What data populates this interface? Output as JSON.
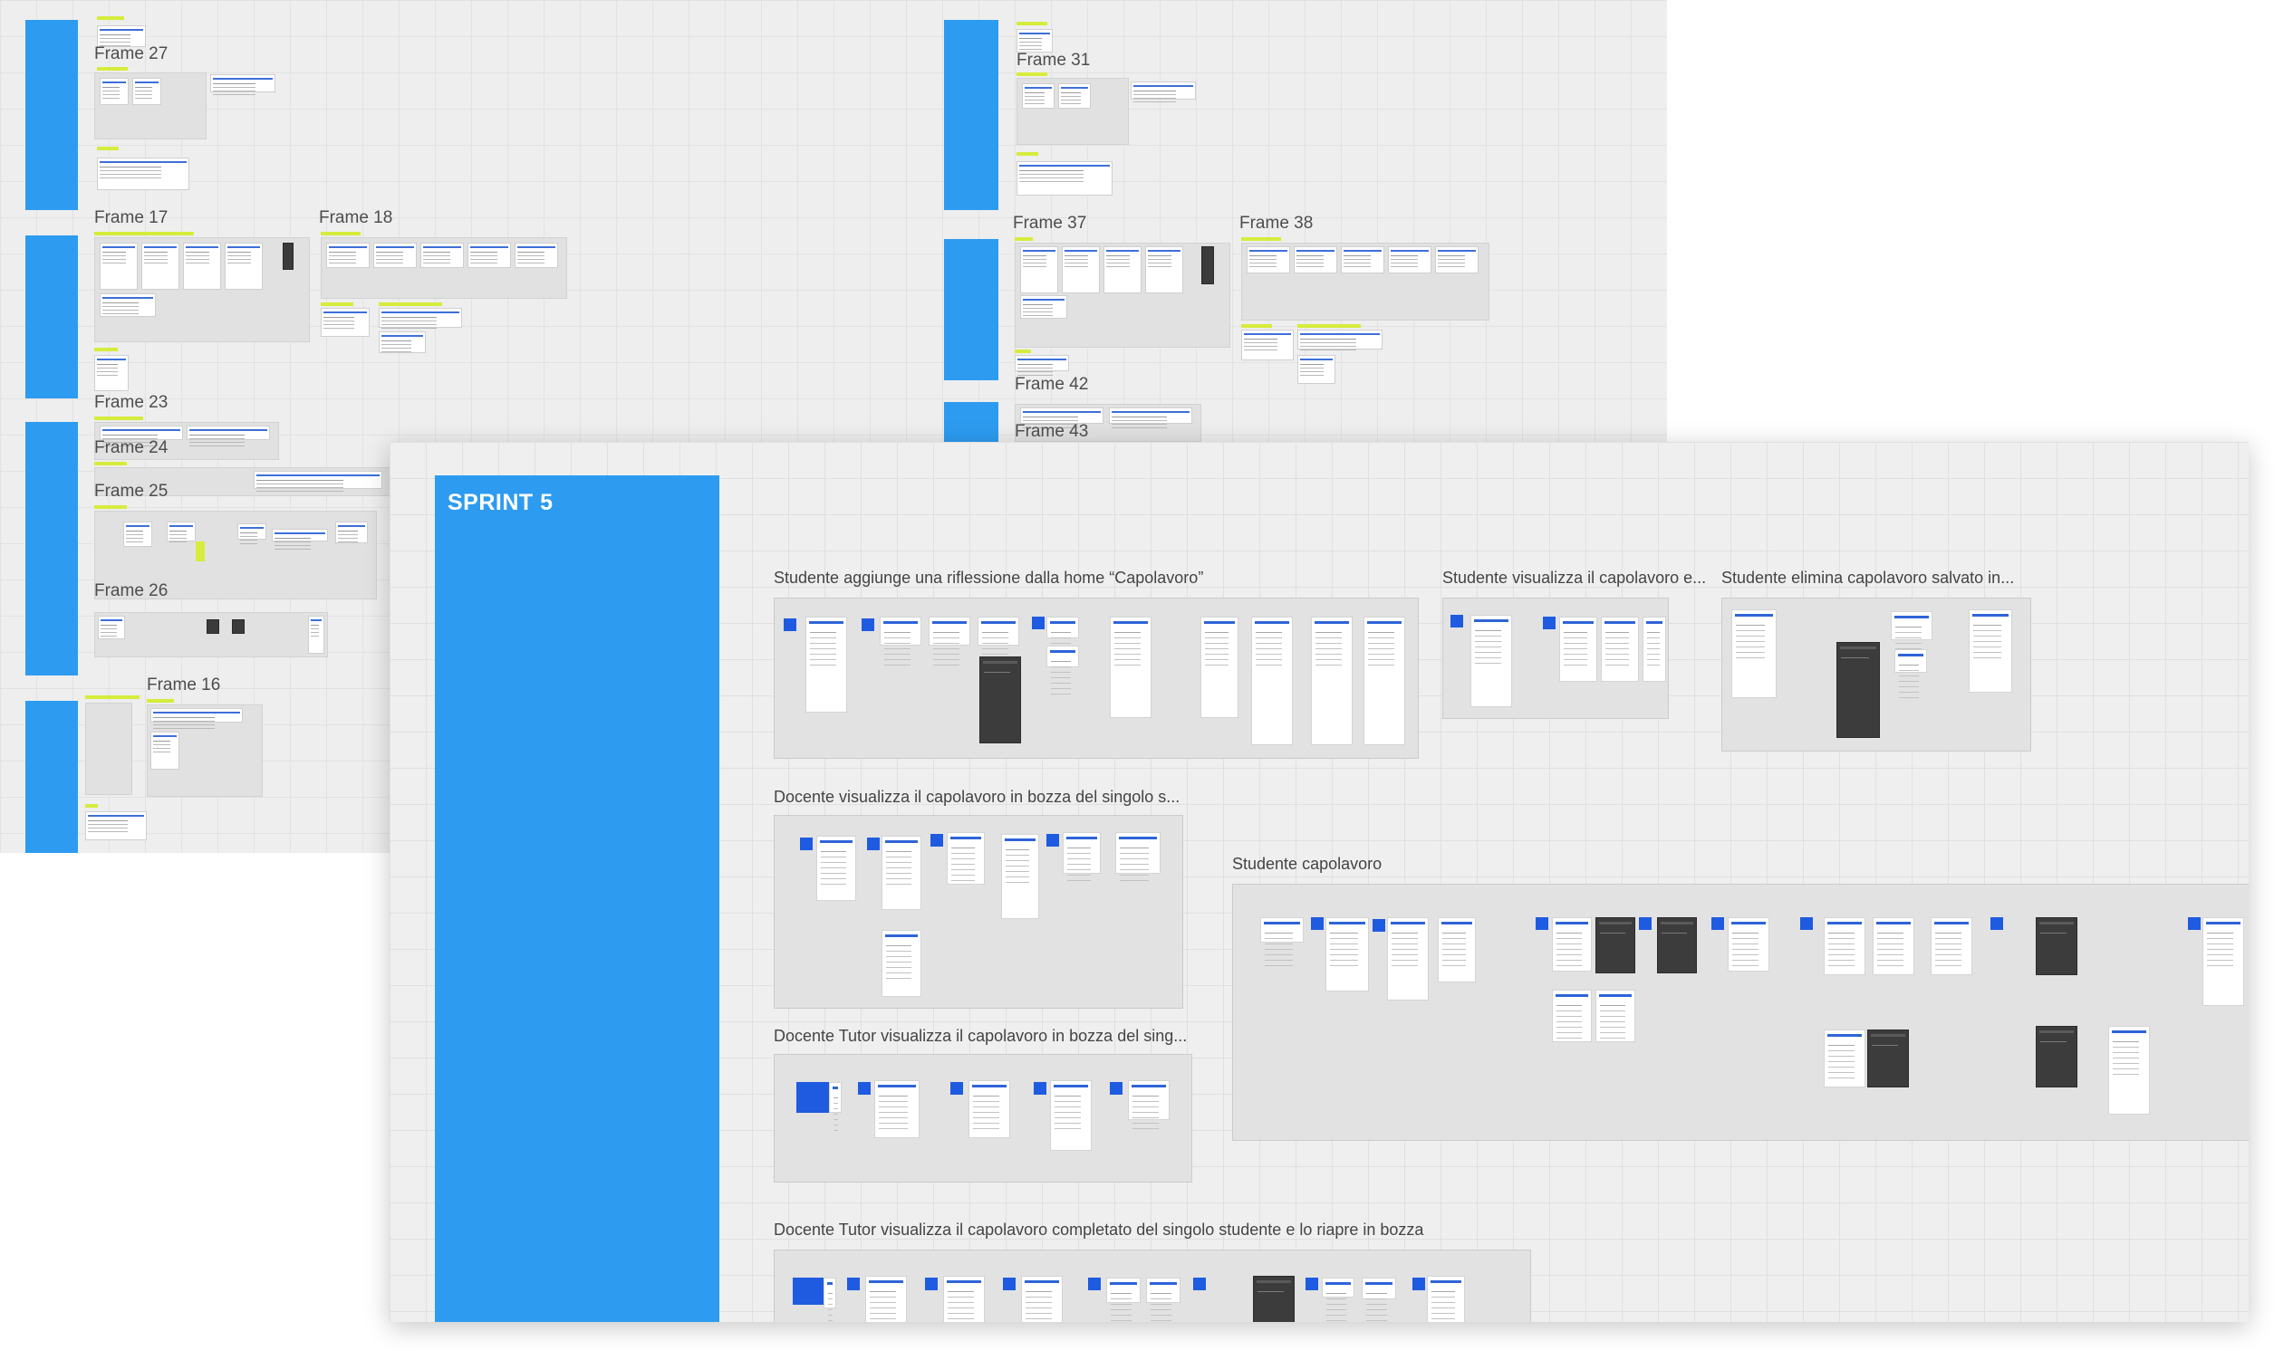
{
  "board": {
    "frames": [
      {
        "name": "Frame 27"
      },
      {
        "name": "Frame 17"
      },
      {
        "name": "Frame 18"
      },
      {
        "name": "Frame 23"
      },
      {
        "name": "Frame 24"
      },
      {
        "name": "Frame 25"
      },
      {
        "name": "Frame 26"
      },
      {
        "name": "Frame 16"
      },
      {
        "name": "Frame 31"
      },
      {
        "name": "Frame 37"
      },
      {
        "name": "Frame 38"
      },
      {
        "name": "Frame 42"
      },
      {
        "name": "Frame 43"
      }
    ]
  },
  "panel": {
    "sprint_title": "SPRINT 5",
    "frames": [
      {
        "title": "Studente aggiunge una riflessione dalla home “Capolavoro”"
      },
      {
        "title": "Studente visualizza il capolavoro e..."
      },
      {
        "title": "Studente elimina capolavoro salvato in..."
      },
      {
        "title": "Docente visualizza il capolavoro in bozza del singolo s..."
      },
      {
        "title": "Studente capolavoro"
      },
      {
        "title": "Docente Tutor visualizza il capolavoro in bozza del sing..."
      },
      {
        "title": "Docente Tutor visualizza il capolavoro completato del singolo studente e lo riapre in bozza"
      }
    ]
  }
}
